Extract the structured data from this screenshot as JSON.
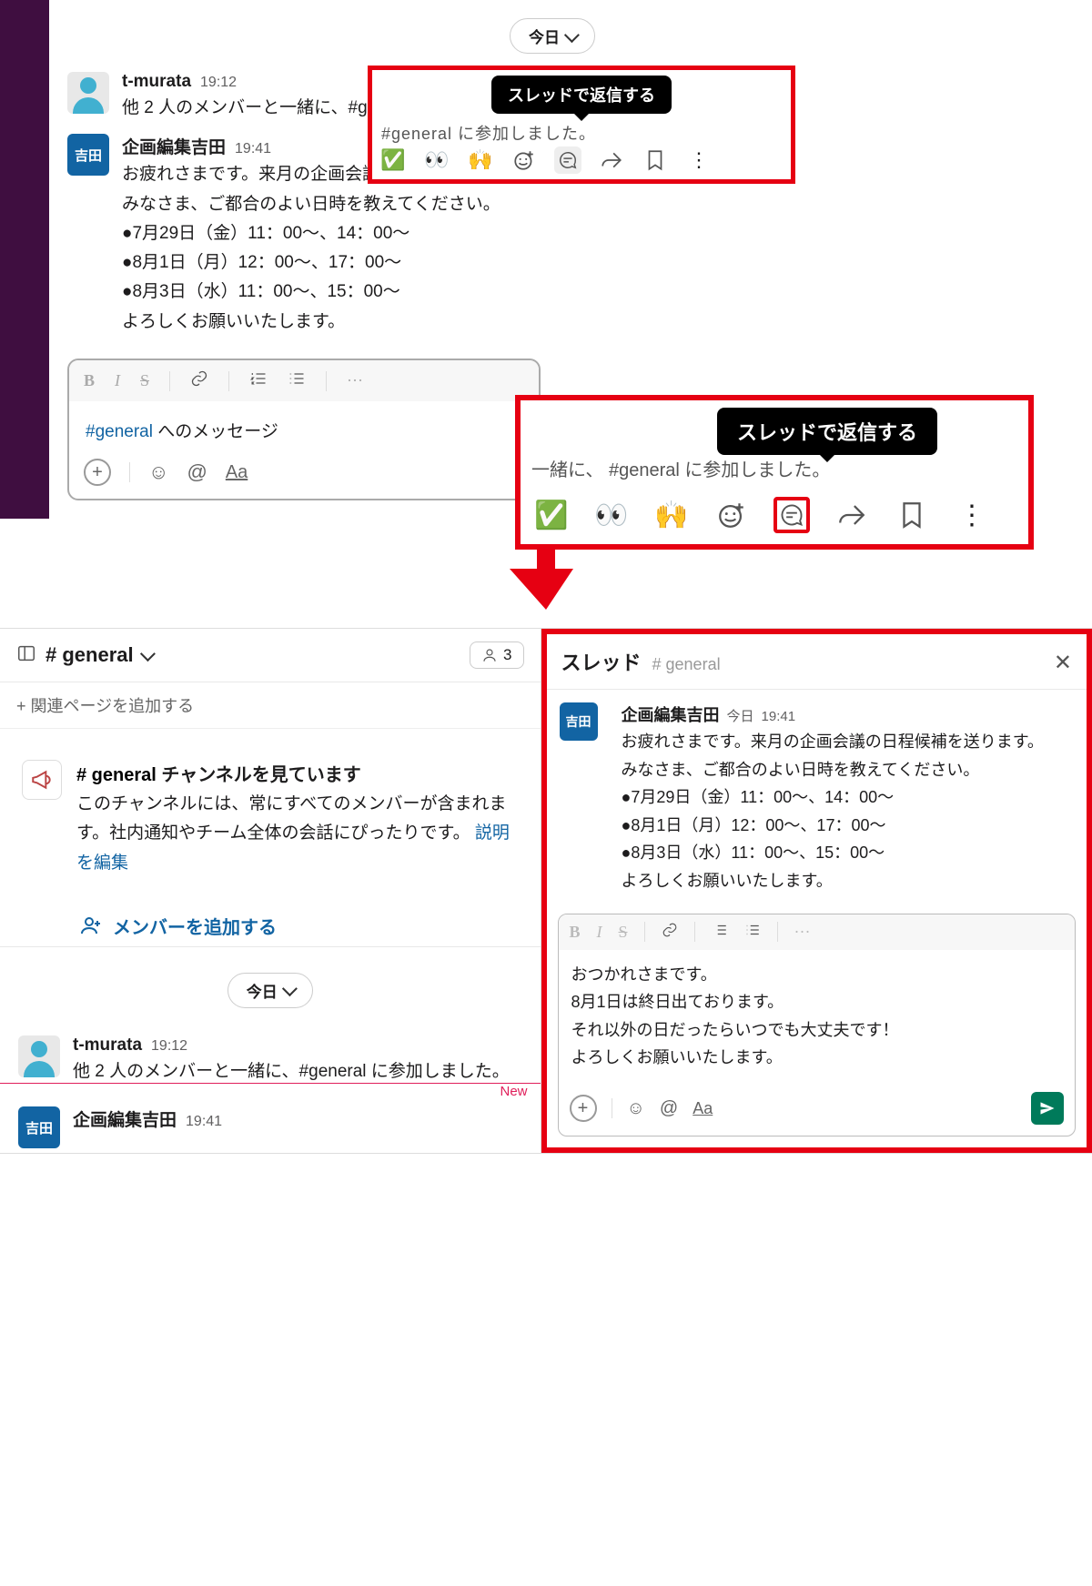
{
  "top": {
    "date_pill": "今日",
    "msg1": {
      "user": "t-murata",
      "time": "19:12",
      "text": "他 2 人のメンバーと一緒に、#general に参加しました。"
    },
    "msg2": {
      "user": "企画編集吉田",
      "avatar_label": "吉田",
      "time": "19:41",
      "lines": [
        "お疲れさまです。来月の企画会議の日程候補を送ります。",
        "みなさま、ご都合のよい日時を教えてください。",
        "●7月29日（金）11：00〜、14：00〜",
        "●8月1日（月）12：00〜、17：00〜",
        "●8月3日（水）11：00〜、15：00〜",
        "よろしくお願いいたします。"
      ]
    },
    "tooltip": "スレッドで返信する",
    "hover_partial_small": "#general に参加しました。",
    "hover_partial_large": "一緒に、 #general に参加しました。",
    "composer_placeholder_prefix": "#general",
    "composer_placeholder_suffix": " へのメッセージ"
  },
  "bottom": {
    "channel_name": "# general",
    "member_count": "3",
    "add_page": "+ 関連ページを追加する",
    "info_title_hash": "# general ",
    "info_title_rest": "チャンネルを見ています",
    "info_desc": "このチャンネルには、常にすべてのメンバーが含まれます。社内通知やチーム全体の会話にぴったりです。 ",
    "info_link": "説明を編集",
    "add_member": "メンバーを追加する",
    "date_pill": "今日",
    "msg1": {
      "user": "t-murata",
      "time": "19:12",
      "text": "他 2 人のメンバーと一緒に、#general に参加しました。"
    },
    "msg2": {
      "user": "企画編集吉田",
      "time": "19:41"
    },
    "new_label": "New"
  },
  "thread": {
    "title": "スレッド",
    "channel": "# general",
    "origin": {
      "user": "企画編集吉田",
      "avatar_label": "吉田",
      "day": "今日",
      "time": "19:41",
      "lines": [
        "お疲れさまです。来月の企画会議の日程候補を送ります。",
        "みなさま、ご都合のよい日時を教えてください。",
        "●7月29日（金）11：00〜、14：00〜",
        "●8月1日（月）12：00〜、17：00〜",
        "●8月3日（水）11：00〜、15：00〜",
        "よろしくお願いいたします。"
      ]
    },
    "reply_lines": [
      "おつかれさまです。",
      "8月1日は終日出ております。",
      "それ以外の日だったらいつでも大丈夫です！",
      "よろしくお願いいたします。"
    ]
  },
  "icons": {
    "check": "✅",
    "eyes": "👀",
    "raised_hands": "🙌",
    "more_dots": "⋮",
    "ellipsis": "···",
    "at": "@",
    "aa": "Aa",
    "smile": "☺",
    "plus": "+"
  }
}
